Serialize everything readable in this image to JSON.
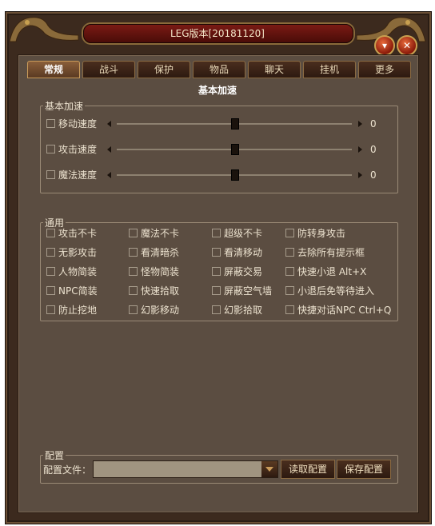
{
  "window": {
    "title": "LEG版本[20181120]",
    "minimize_symbol": "▾",
    "close_symbol": "✕"
  },
  "tabs": [
    "常规",
    "战斗",
    "保护",
    "物品",
    "聊天",
    "挂机",
    "更多"
  ],
  "active_tab": "常规",
  "heading": "基本加速",
  "speed_group": {
    "legend": "基本加速",
    "items": [
      {
        "label": "移动速度",
        "value": "0",
        "checked": false,
        "level": 0.5
      },
      {
        "label": "攻击速度",
        "value": "0",
        "checked": false,
        "level": 0.5
      },
      {
        "label": "魔法速度",
        "value": "0",
        "checked": false,
        "level": 0.5
      }
    ]
  },
  "general_group": {
    "legend": "通用",
    "rows": [
      [
        "攻击不卡",
        "魔法不卡",
        "超级不卡",
        "防转身攻击"
      ],
      [
        "无影攻击",
        "看清暗杀",
        "看清移动",
        "去除所有提示框"
      ],
      [
        "人物简装",
        "怪物简装",
        "屏蔽交易",
        "快速小退 Alt+X"
      ],
      [
        "NPC简装",
        "快速拾取",
        "屏蔽空气墙",
        "小退后免等待进入"
      ],
      [
        "防止挖地",
        "幻影移动",
        "幻影拾取",
        "快捷对话NPC Ctrl+Q"
      ]
    ]
  },
  "config": {
    "legend": "配置",
    "file_label": "配置文件：",
    "file_value": "",
    "read_button": "读取配置",
    "save_button": "保存配置"
  },
  "colors": {
    "frame": "#3c2a1e",
    "panel": "#5b4d41",
    "title_bar": "#7a1a14",
    "accent": "#c89a5a"
  }
}
